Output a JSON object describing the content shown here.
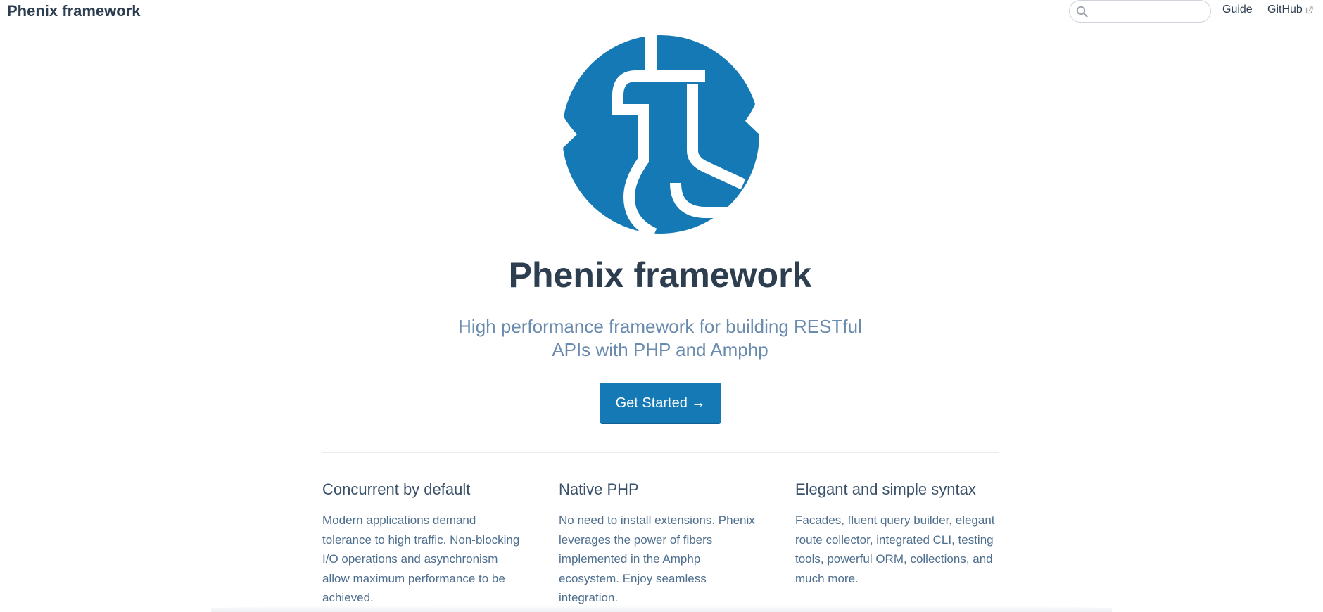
{
  "navbar": {
    "site_name": "Phenix framework",
    "search": {
      "value": "",
      "placeholder": ""
    },
    "links": [
      {
        "label": "Guide"
      },
      {
        "label": "GitHub"
      }
    ]
  },
  "hero": {
    "title": "Phenix framework",
    "tagline": "High performance framework for building RESTful APIs with PHP and Amphp",
    "cta_label": "Get Started →"
  },
  "features": [
    {
      "title": "Concurrent by default",
      "details": "Modern applications demand tolerance to high traffic. Non-blocking I/O operations and asynchronism allow maximum performance to be achieved."
    },
    {
      "title": "Native PHP",
      "details": "No need to install extensions. Phenix leverages the power of fibers implemented in the Amphp ecosystem. Enjoy seamless integration."
    },
    {
      "title": "Elegant and simple syntax",
      "details": "Facades, fluent query builder, elegant route collector, integrated CLI, testing tools, powerful ORM, collections, and much more."
    }
  ],
  "icons": {
    "search": "search-icon",
    "external_link": "external-link-icon",
    "logo": "phenix-logo"
  },
  "colors": {
    "brand": "#1479b4",
    "text": "#2c3e50",
    "tagline": "#6a8bad"
  }
}
